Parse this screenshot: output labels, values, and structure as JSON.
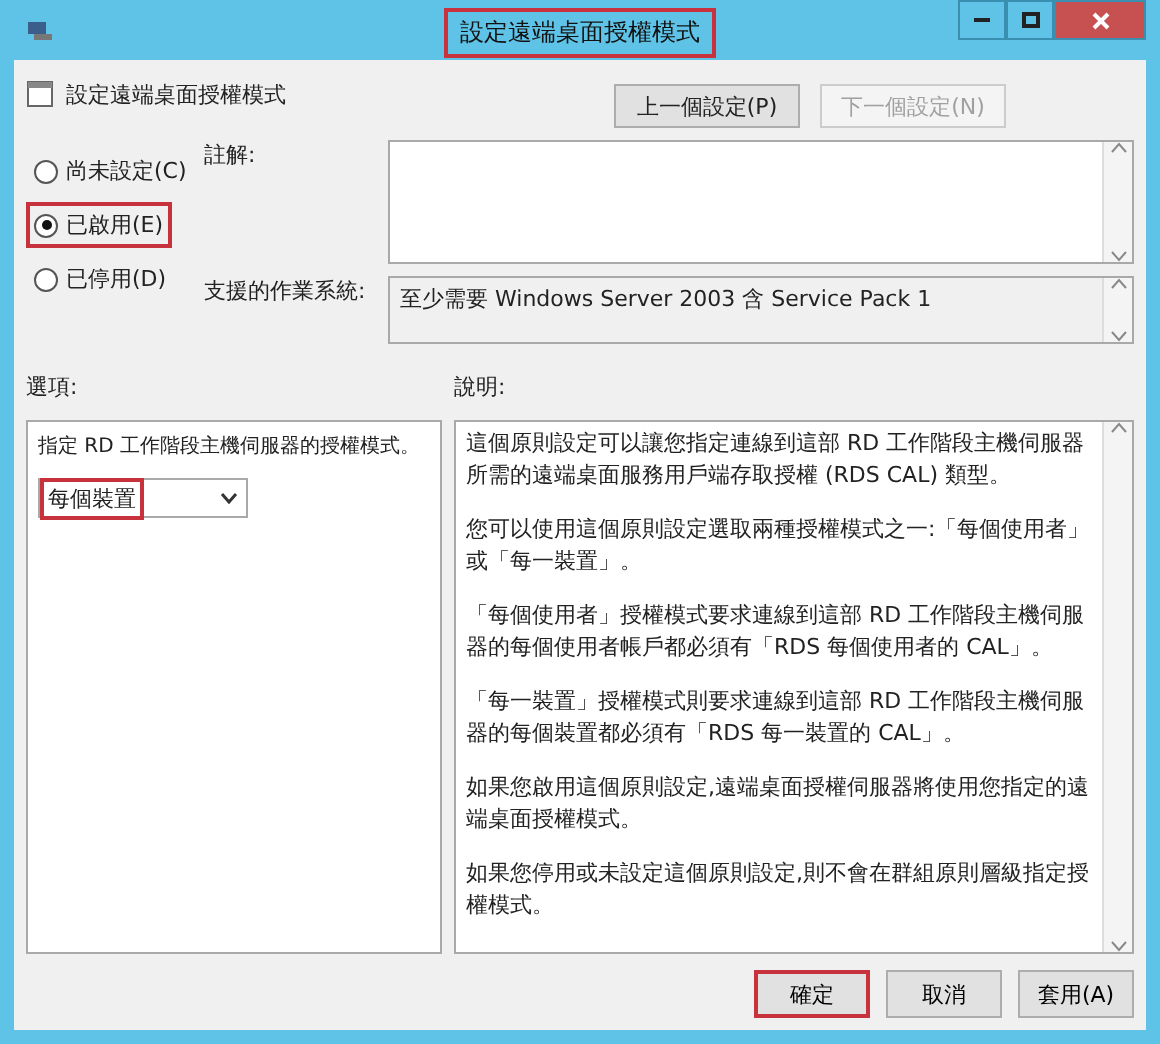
{
  "window": {
    "title": "設定遠端桌面授權模式",
    "title_highlighted": true
  },
  "header": {
    "policy_name": "設定遠端桌面授權模式",
    "buttons": [
      {
        "label": "上一個設定(P)",
        "disabled": false
      },
      {
        "label": "下一個設定(N)",
        "disabled": true
      }
    ]
  },
  "states": [
    {
      "label": "尚未設定(C)",
      "selected": false,
      "highlighted": false
    },
    {
      "label": "已啟用(E)",
      "selected": true,
      "highlighted": true
    },
    {
      "label": "已停用(D)",
      "selected": false,
      "highlighted": false
    }
  ],
  "comment": {
    "label": "註解:"
  },
  "supported": {
    "label": "支援的作業系統:",
    "value": "至少需要 Windows Server 2003 含 Service Pack 1"
  },
  "options": {
    "label": "選項:",
    "prompt": "指定 RD 工作階段主機伺服器的授權模式。",
    "select_value": "每個裝置",
    "select_highlighted": true
  },
  "help": {
    "label": "說明:",
    "paragraphs": [
      "這個原則設定可以讓您指定連線到這部 RD 工作階段主機伺服器所需的遠端桌面服務用戶端存取授權 (RDS CAL) 類型。",
      "您可以使用這個原則設定選取兩種授權模式之一:「每個使用者」或「每一裝置」。",
      "「每個使用者」授權模式要求連線到這部 RD 工作階段主機伺服器的每個使用者帳戶都必須有「RDS 每個使用者的 CAL」。",
      "「每一裝置」授權模式則要求連線到這部 RD 工作階段主機伺服器的每個裝置都必須有「RDS 每一裝置的 CAL」。",
      "如果您啟用這個原則設定,遠端桌面授權伺服器將使用您指定的遠端桌面授權模式。",
      "如果您停用或未設定這個原則設定,則不會在群組原則層級指定授權模式。"
    ]
  },
  "footer": {
    "buttons": [
      {
        "label": "確定",
        "highlighted": true
      },
      {
        "label": "取消",
        "highlighted": false
      },
      {
        "label": "套用(A)",
        "highlighted": false
      }
    ]
  }
}
